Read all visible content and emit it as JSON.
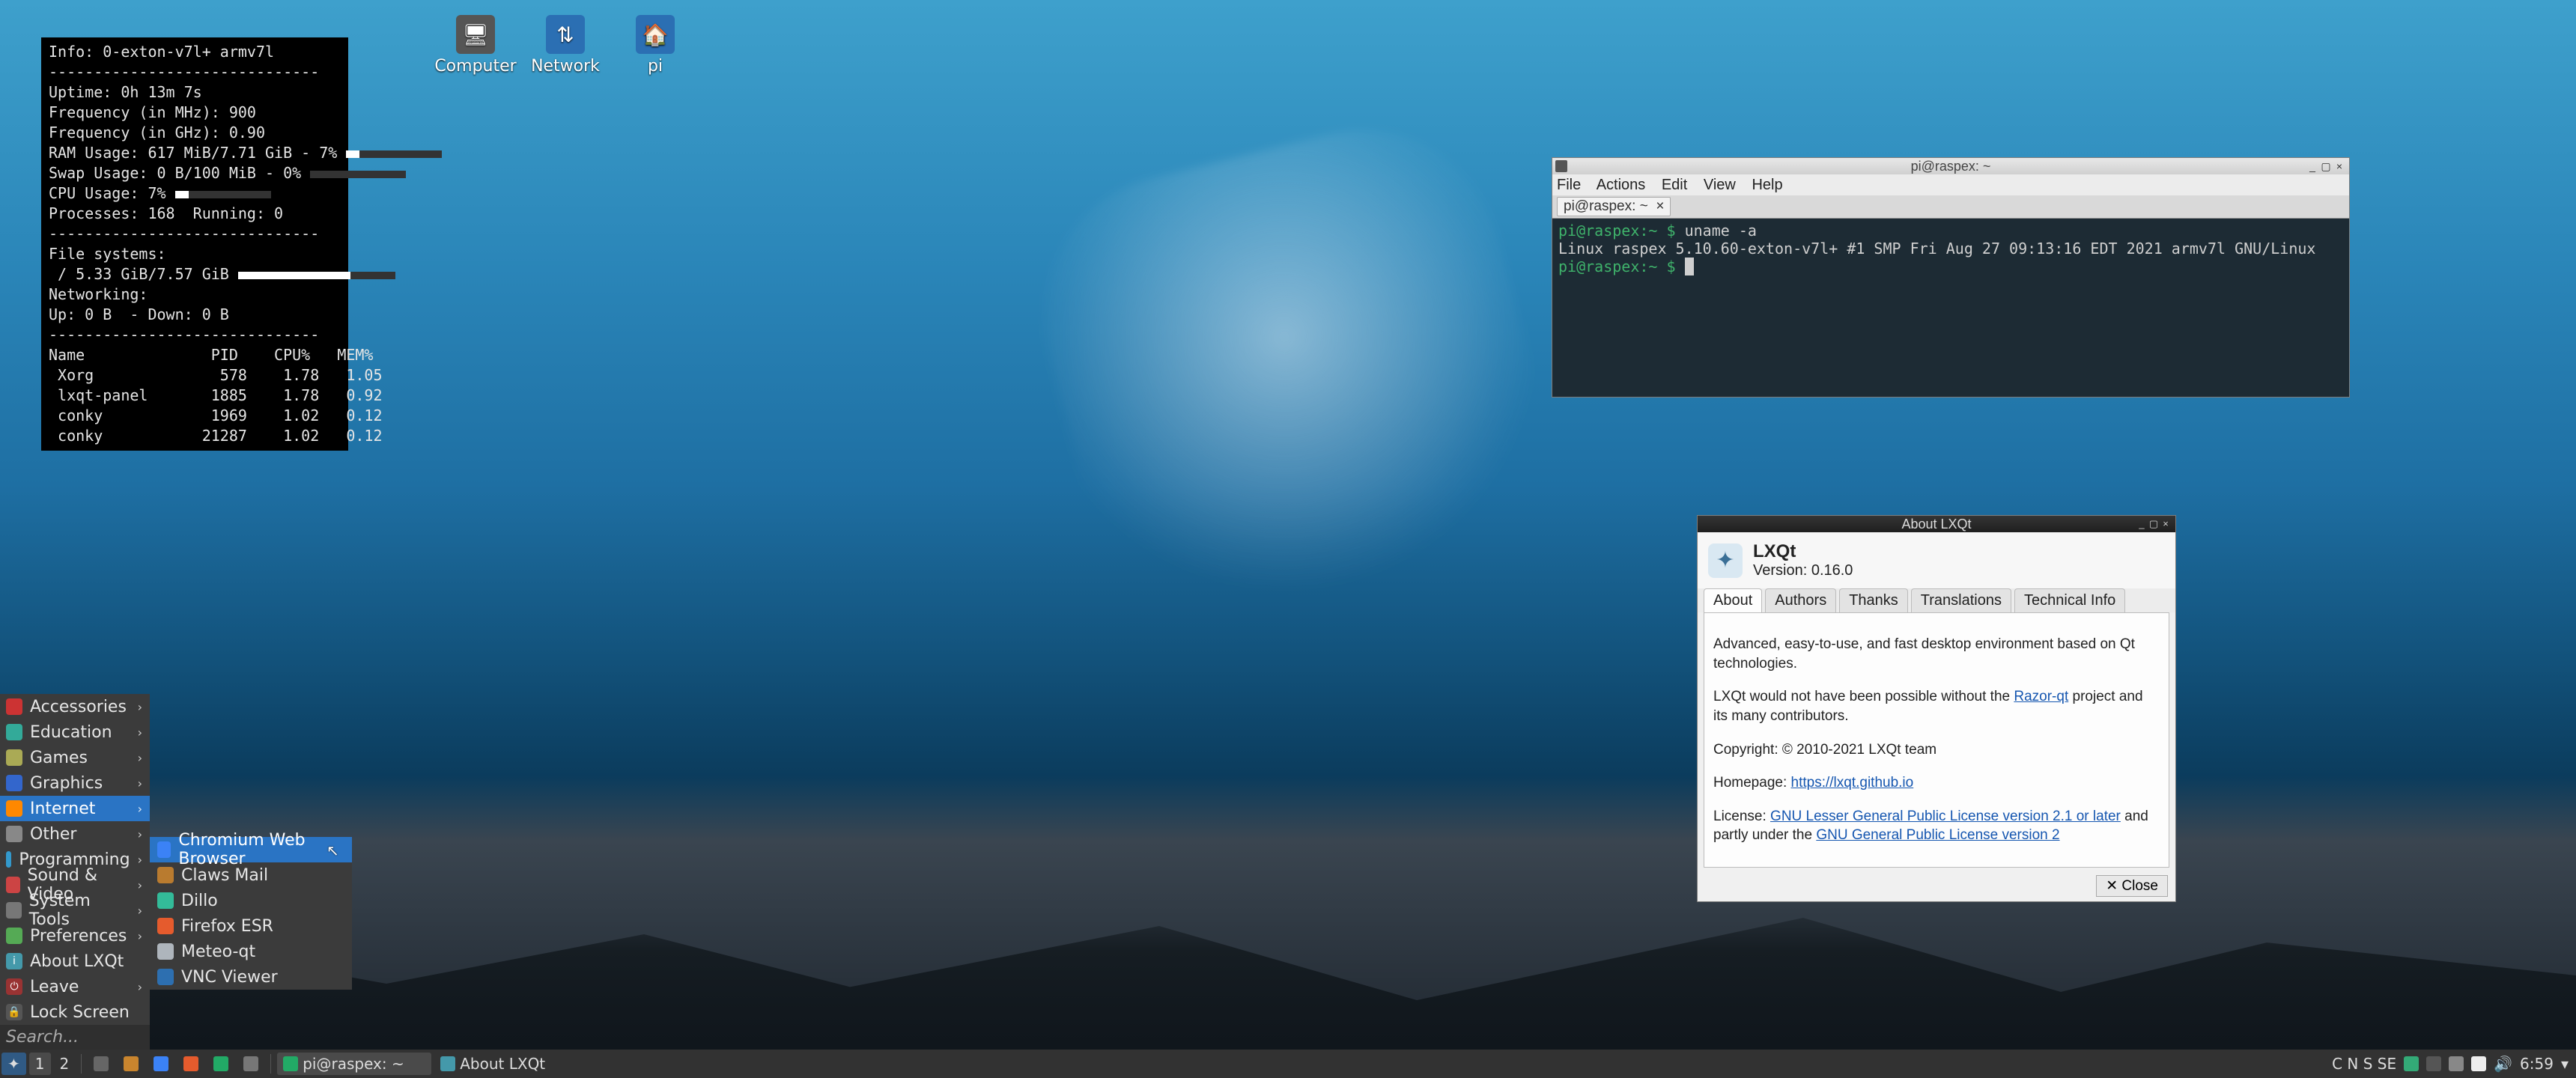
{
  "desktop_icons": [
    {
      "name": "computer",
      "label": "Computer",
      "color": "#555"
    },
    {
      "name": "network",
      "label": "Network",
      "color": "#2b6fb3"
    },
    {
      "name": "pi",
      "label": "pi",
      "color": "#2b6fb3"
    }
  ],
  "conky": {
    "info_line": "Info: 0-exton-v7l+ armv7l",
    "uptime": "Uptime: 0h 13m 7s",
    "freq_mhz": "Frequency (in MHz): 900",
    "freq_ghz": "Frequency (in GHz): 0.90",
    "ram": "RAM Usage: 617 MiB/7.71 GiB - 7%",
    "swap": "Swap Usage: 0 B/100 MiB - 0%",
    "cpu": "CPU Usage: 7%",
    "procs": "Processes: 168  Running: 0",
    "fs_title": "File systems:",
    "fs_line": " / 5.33 GiB/7.57 GiB",
    "net_title": "Networking:",
    "net_line": "Up: 0 B  - Down: 0 B",
    "proc_header": "Name              PID    CPU%   MEM%",
    "proc_rows": [
      " Xorg              578    1.78   1.05",
      " lxqt-panel       1885    1.78   0.92",
      " conky            1969    1.02   0.12",
      " conky           21287    1.02   0.12"
    ]
  },
  "menu": {
    "items": [
      {
        "key": "accessories",
        "label": "Accessories",
        "color": "#c33"
      },
      {
        "key": "education",
        "label": "Education",
        "color": "#3a9"
      },
      {
        "key": "games",
        "label": "Games",
        "color": "#aa5"
      },
      {
        "key": "graphics",
        "label": "Graphics",
        "color": "#36c"
      },
      {
        "key": "internet",
        "label": "Internet",
        "color": "#f80",
        "selected": true
      },
      {
        "key": "other",
        "label": "Other",
        "color": "#888"
      },
      {
        "key": "programming",
        "label": "Programming",
        "color": "#39c"
      },
      {
        "key": "sound-video",
        "label": "Sound & Video",
        "color": "#c44"
      },
      {
        "key": "system-tools",
        "label": "System Tools",
        "color": "#777"
      },
      {
        "key": "preferences",
        "label": "Preferences",
        "color": "#5a5"
      }
    ],
    "bottom": [
      {
        "key": "about-lxqt",
        "label": "About LXQt"
      },
      {
        "key": "leave",
        "label": "Leave",
        "arrow": true
      },
      {
        "key": "lock-screen",
        "label": "Lock Screen"
      }
    ],
    "search_placeholder": "Search..."
  },
  "submenu": {
    "items": [
      {
        "key": "chromium",
        "label": "Chromium Web Browser",
        "color": "#3b82f6",
        "selected": true
      },
      {
        "key": "claws",
        "label": "Claws Mail",
        "color": "#b97b2f"
      },
      {
        "key": "dillo",
        "label": "Dillo",
        "color": "#3b9"
      },
      {
        "key": "firefox",
        "label": "Firefox ESR",
        "color": "#e55b2d"
      },
      {
        "key": "meteo",
        "label": "Meteo-qt",
        "color": "#aeb5bc"
      },
      {
        "key": "vnc",
        "label": "VNC Viewer",
        "color": "#2d6fb0"
      }
    ]
  },
  "terminal": {
    "title": "pi@raspex: ~",
    "menus": [
      "File",
      "Actions",
      "Edit",
      "View",
      "Help"
    ],
    "tab_label": "pi@raspex: ~",
    "lines": [
      {
        "prompt": "pi@raspex:~ $",
        "cmd": " uname -a"
      },
      {
        "out": "Linux raspex 5.10.60-exton-v7l+ #1 SMP Fri Aug 27 09:13:16 EDT 2021 armv7l GNU/Linux"
      },
      {
        "prompt": "pi@raspex:~ $",
        "cmd": " ",
        "cursor": true
      }
    ]
  },
  "about": {
    "title": "About LXQt",
    "name": "LXQt",
    "version": "Version: 0.16.0",
    "tabs": [
      "About",
      "Authors",
      "Thanks",
      "Translations",
      "Technical Info"
    ],
    "active_tab": "About",
    "p1": "Advanced, easy-to-use, and fast desktop environment based on Qt technologies.",
    "p2a": "LXQt would not have been possible without the ",
    "p2_link": "Razor-qt",
    "p2b": " project and its many contributors.",
    "copyright": "Copyright: © 2010-2021 LXQt team",
    "homepage_label": "Homepage: ",
    "homepage_url": "https://lxqt.github.io",
    "license_label": "License: ",
    "license1": "GNU Lesser General Public License version 2.1 or later",
    "license_mid": " and partly under the ",
    "license2": "GNU General Public License version 2",
    "close_label": "✕ Close"
  },
  "taskbar": {
    "workspaces": [
      "1",
      "2"
    ],
    "tasks": [
      {
        "key": "qterm",
        "label": "pi@raspex: ~",
        "ico": "#2a6"
      },
      {
        "key": "about",
        "label": "About LXQt",
        "ico": "#49a"
      }
    ],
    "kb": "C N S SE",
    "clock": "6:59"
  }
}
